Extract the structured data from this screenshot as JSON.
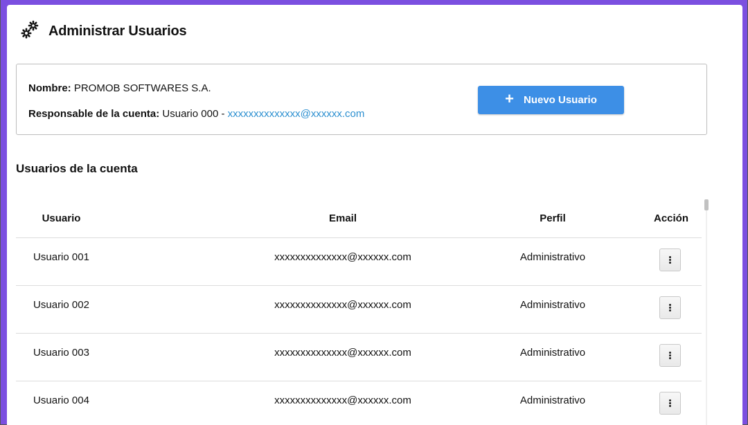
{
  "page": {
    "title": "Administrar Usuarios",
    "header_icon": "gears-icon"
  },
  "account": {
    "name_label": "Nombre:",
    "name_value": "PROMOB SOFTWARES S.A.",
    "owner_label": "Responsable de la cuenta:",
    "owner_value": "Usuario 000 -",
    "owner_email": "xxxxxxxxxxxxxx@xxxxxx.com"
  },
  "actions": {
    "new_user_icon": "plus-icon",
    "new_user_label": "Nuevo Usuario"
  },
  "users_section": {
    "title": "Usuarios de la cuenta",
    "columns": [
      "Usuario",
      "Email",
      "Perfil",
      "Acción"
    ],
    "rows": [
      {
        "user": "Usuario 001",
        "email": "xxxxxxxxxxxxxx@xxxxxx.com",
        "profile": "Administrativo"
      },
      {
        "user": "Usuario 002",
        "email": "xxxxxxxxxxxxxx@xxxxxx.com",
        "profile": "Administrativo"
      },
      {
        "user": "Usuario 003",
        "email": "xxxxxxxxxxxxxx@xxxxxx.com",
        "profile": "Administrativo"
      },
      {
        "user": "Usuario 004",
        "email": "xxxxxxxxxxxxxx@xxxxxx.com",
        "profile": "Administrativo"
      }
    ]
  },
  "colors": {
    "accent_frame": "#7b4fe0",
    "primary_button": "#3d8fe6",
    "link": "#2b8fd0"
  }
}
